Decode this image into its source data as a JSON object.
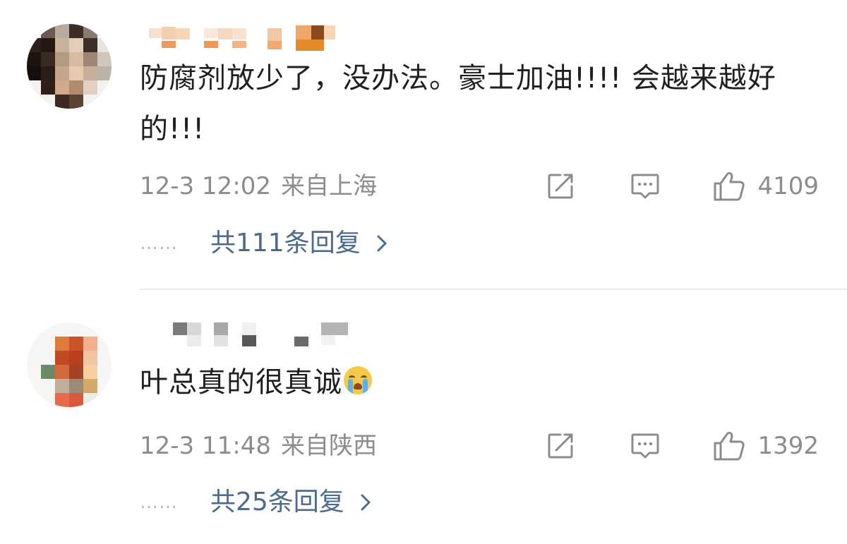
{
  "comments": [
    {
      "text": "防腐剂放少了，没办法。豪士加油!!!! 会越来越好的!!!",
      "time": "12-3 12:02",
      "location": "来自上海",
      "likes": "4109",
      "replies_label": "共111条回复",
      "dots": "……"
    },
    {
      "text": "叶总真的很真诚",
      "emoji": "cry-emoji",
      "time": "12-3 11:48",
      "location": "来自陕西",
      "likes": "1392",
      "replies_label": "共25条回复",
      "dots": "……"
    }
  ],
  "icons": {
    "share": "share-icon",
    "comment": "comment-icon",
    "like": "thumbs-up-icon",
    "chevron": "chevron-right-icon"
  },
  "colors": {
    "reply_link": "#4a6b8f",
    "meta": "#8c8c8c",
    "text": "#1f1f1f"
  }
}
